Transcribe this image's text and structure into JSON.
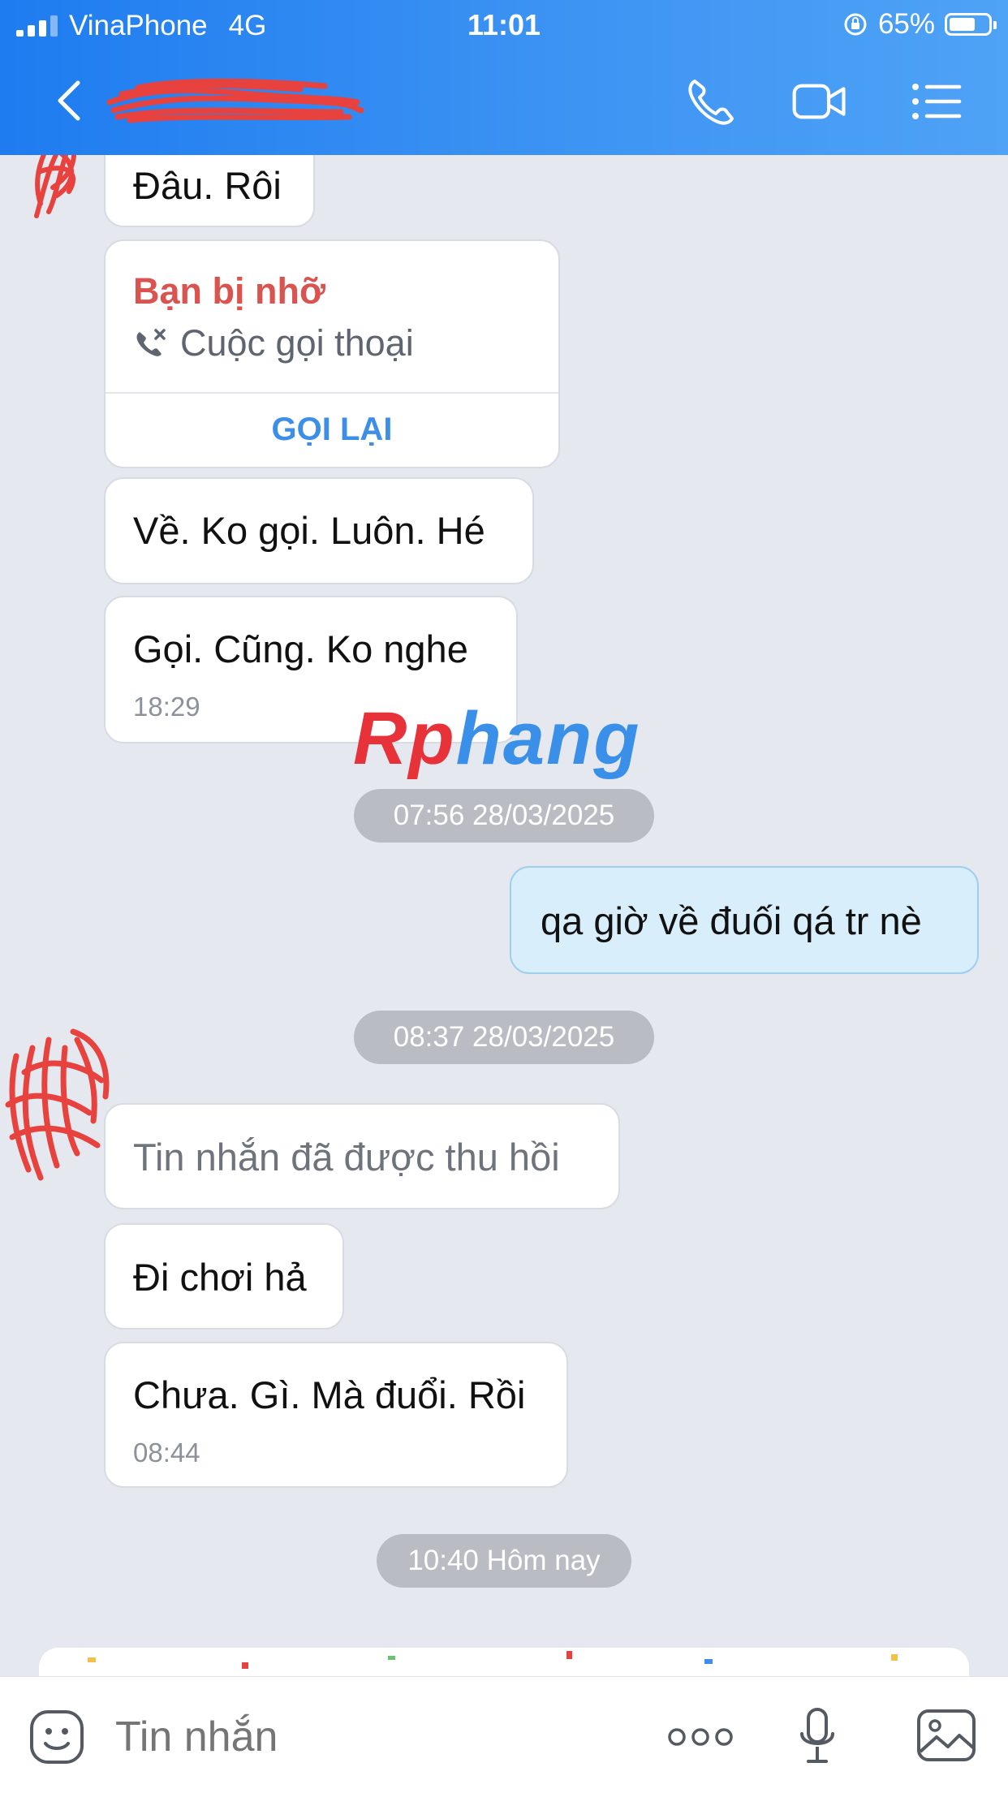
{
  "status_bar": {
    "carrier": "VinaPhone",
    "network": "4G",
    "time": "11:01",
    "battery": "65%"
  },
  "header": {
    "back_icon": "chevron-left-icon",
    "actions": [
      "phone-icon",
      "video-camera-icon",
      "menu-list-icon"
    ]
  },
  "messages": {
    "m1": {
      "text": "Đâu. Rôi"
    },
    "missed_call": {
      "title": "Bạn bị nhỡ",
      "subtitle": "Cuộc gọi thoại",
      "action": "GỌI LẠI"
    },
    "m2": {
      "text": "Về. Ko gọi. Luôn. Hé"
    },
    "m3": {
      "text": "Gọi. Cũng. Ko nghe",
      "time": "18:29"
    },
    "date1": "07:56 28/03/2025",
    "m4": {
      "text": "qa giờ về đuối qá tr nè"
    },
    "date2": "08:37 28/03/2025",
    "m5": {
      "text": "Tin nhắn đã được thu hồi"
    },
    "m6": {
      "text": "Đi chơi hả"
    },
    "m7": {
      "text": "Chưa. Gì. Mà đuổi. Rồi",
      "time": "08:44"
    },
    "date3": "10:40 Hôm nay"
  },
  "watermark": {
    "part1": "Rp",
    "part2": "hang"
  },
  "input_bar": {
    "placeholder": "Tin nhắn",
    "icons": [
      "sticker-icon",
      "more-icon",
      "microphone-icon",
      "image-icon"
    ]
  },
  "colors": {
    "header_blue": "#1e7cf0",
    "missed_red": "#d9534f",
    "link_blue": "#3d8ee8",
    "outgoing_bubble": "#d8effb"
  }
}
